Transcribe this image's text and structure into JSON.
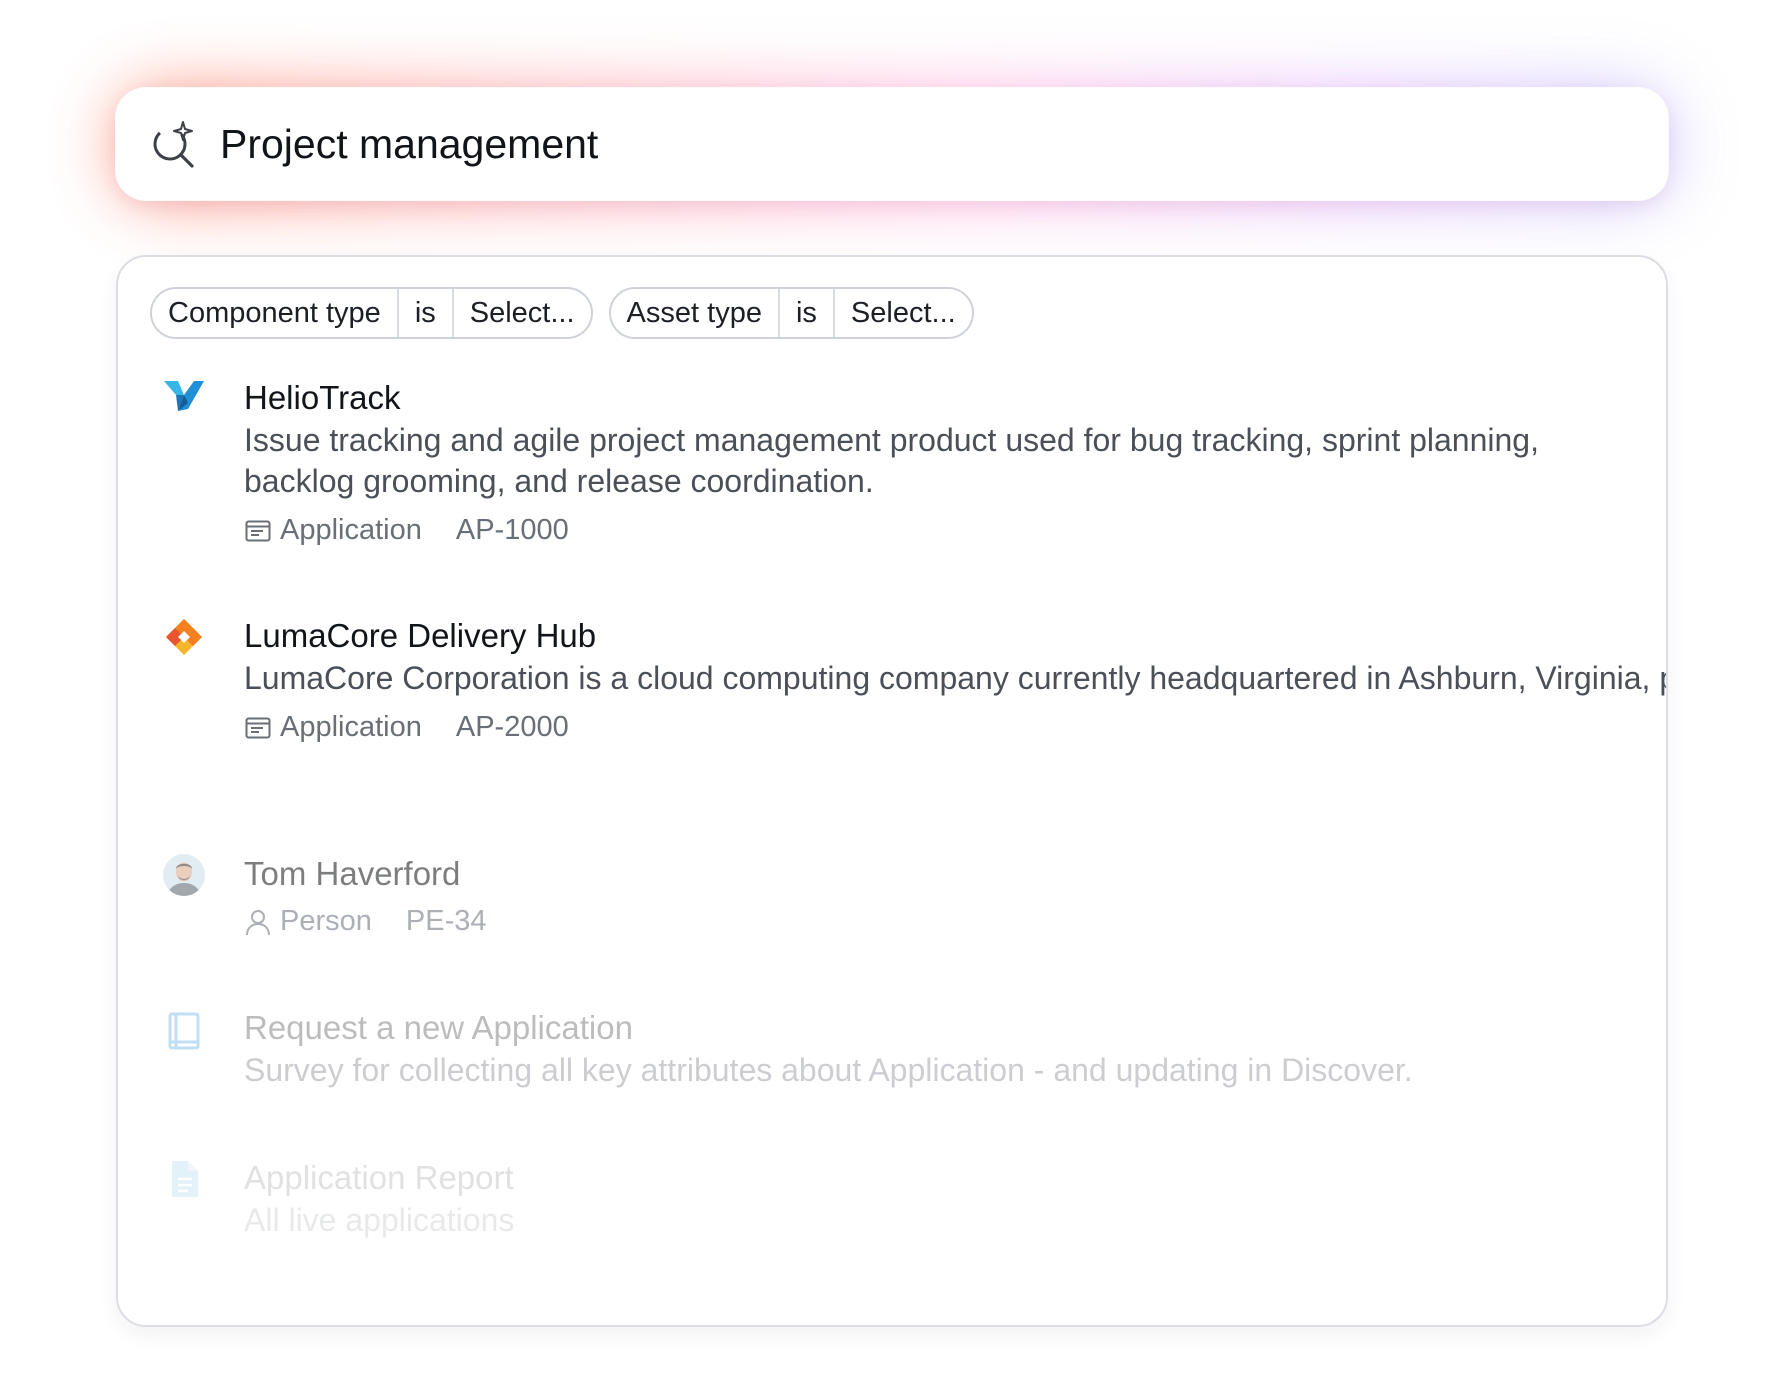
{
  "search": {
    "query": "Project management"
  },
  "filters": [
    {
      "field": "Component type",
      "operator": "is",
      "value": "Select..."
    },
    {
      "field": "Asset type",
      "operator": "is",
      "value": "Select..."
    }
  ],
  "results": [
    {
      "icon": "heliotrack-logo-icon",
      "title": "HelioTrack",
      "description": "Issue tracking and agile project management product used for bug tracking, sprint planning, backlog grooming, and release coordination.",
      "type_icon": "application-icon",
      "type": "Application",
      "code": "AP-1000"
    },
    {
      "icon": "lumacore-logo-icon",
      "title": "LumaCore Delivery Hub",
      "description": "LumaCore Corporation is a cloud computing company currently headquartered in Ashburn, Virginia, part of the Dulles Technology Corridor. LumaCore sells a Platform as a Service fo...",
      "type_icon": "application-icon",
      "type": "Application",
      "code": "AP-2000"
    },
    {
      "icon": "avatar",
      "title": "Tom Haverford",
      "type_icon": "person-icon",
      "type": "Person",
      "code": "PE-34"
    },
    {
      "icon": "survey-icon",
      "title": "Request a new Application",
      "description": "Survey for collecting all key attributes about Application - and updating in Discover."
    },
    {
      "icon": "document-icon",
      "title": "Application Report",
      "description": "All live applications"
    }
  ],
  "colors": {
    "glow_start": "#ff6a4a",
    "glow_mid": "#ff9fd8",
    "glow_end": "#b9b2ff",
    "heliotrack_blue": "#1f8fd6",
    "lumacore_orange": "#f59a1b"
  }
}
